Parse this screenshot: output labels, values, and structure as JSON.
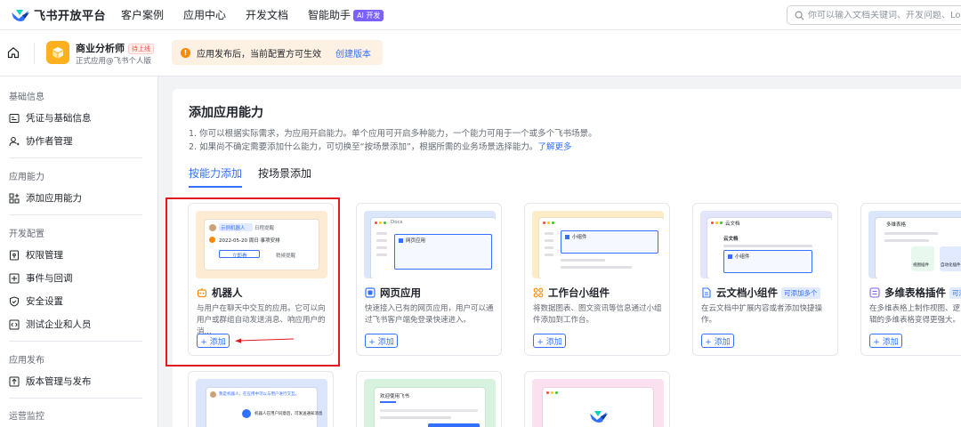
{
  "brand": {
    "name": "飞书开放平台"
  },
  "nav": {
    "items": [
      "客户案例",
      "应用中心",
      "开发文档",
      "智能助手"
    ],
    "ai_badge": "AI 开发"
  },
  "search": {
    "placeholder": "你可以输入文档关键词、开发问题、Log"
  },
  "app": {
    "name": "商业分析师",
    "status": "待上线",
    "subtitle": "正式应用@飞书个人版",
    "notice": "应用发布后，当前配置方可生效",
    "notice_action": "创建版本"
  },
  "sidebar": {
    "groups": [
      {
        "label": "基础信息",
        "items": [
          "凭证与基础信息",
          "协作者管理"
        ]
      },
      {
        "label": "应用能力",
        "items": [
          "添加应用能力"
        ]
      },
      {
        "label": "开发配置",
        "items": [
          "权限管理",
          "事件与回调",
          "安全设置",
          "测试企业和人员"
        ]
      },
      {
        "label": "应用发布",
        "items": [
          "版本管理与发布"
        ]
      },
      {
        "label": "运营监控",
        "items": []
      }
    ]
  },
  "main": {
    "title": "添加应用能力",
    "desc1": "1. 你可以根据实际需求，为应用开启能力。单个应用可开启多种能力，一个能力可用于一个或多个飞书场景。",
    "desc2": "2. 如果尚不确定需要添加什么能力，可切换至“按场景添加”，根据所需的业务场景选择能力。",
    "desc2_link": "了解更多",
    "tabs": [
      "按能力添加",
      "按场景添加"
    ],
    "add_label": "+ 添加",
    "cards": [
      {
        "title": "机器人",
        "tag": "",
        "desc": "与用户在聊天中交互的应用。它可以向用户或群组自动发送消息、响应用户的消..."
      },
      {
        "title": "网页应用",
        "tag": "",
        "desc": "快速接入已有的网页应用，用户可以通过飞书客户端免登录快速进入。"
      },
      {
        "title": "工作台小组件",
        "tag": "",
        "desc": "将数据图表、图文资讯等信息通过小组件添加到工作台。"
      },
      {
        "title": "云文档小组件",
        "tag": "可添加多个",
        "desc": "在云文档中扩展内容或者添加快捷操作。"
      },
      {
        "title": "多维表格插件",
        "tag": "可添",
        "desc": "在多维表格上制作视图、逻辑的多维表格变得更强大。"
      }
    ],
    "previews": {
      "bot_name": "示例机器人",
      "bot_tag": "机器人",
      "bot_msg_title": "日程提醒",
      "bot_date": "2022-05-20 周日 事项安排",
      "bot_btn1": "立即看",
      "bot_btn2": "稍候提醒",
      "web_tab": "Docs",
      "web_item": "网页应用",
      "widget_item": "小组件",
      "doc_title": "云文档",
      "doc_sub": "云文档",
      "doc_item": "小组件",
      "bitable_title": "多维表格",
      "bitable_t1": "视图插件",
      "bitable_t2": "自动化插件",
      "row2_welcome": "欢迎使用飞书",
      "row2_chat1": "我是机器人，在应用中可以与用户进行交互。",
      "row2_chat2": "机器人在用户同意后，可发送通知消息"
    }
  },
  "colors": {
    "accent": "#3370ff",
    "highlight": "#e4181f",
    "notice_bg": "#fdf1e4",
    "warning": "#ff8800"
  }
}
